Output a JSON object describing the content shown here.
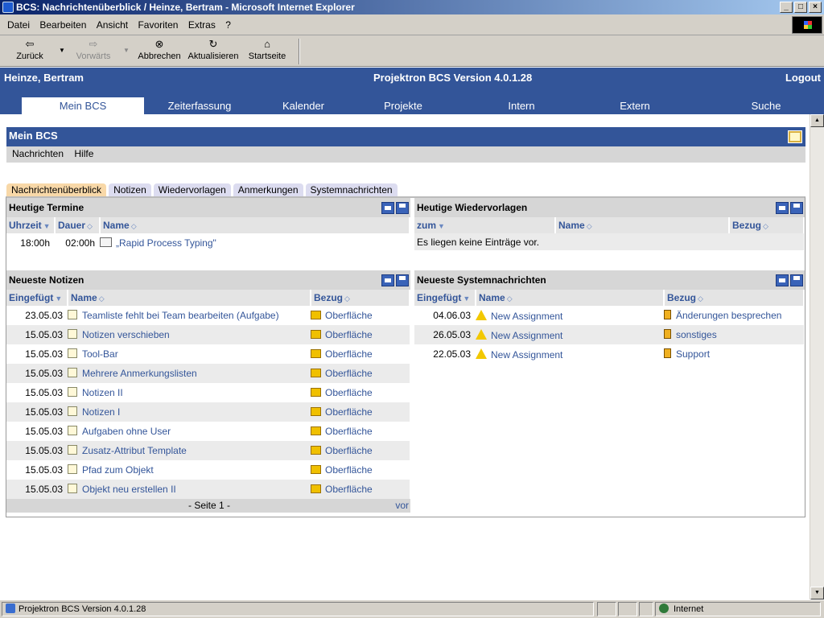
{
  "window": {
    "title": "BCS: Nachrichtenüberblick / Heinze, Bertram - Microsoft Internet Explorer"
  },
  "menu": [
    "Datei",
    "Bearbeiten",
    "Ansicht",
    "Favoriten",
    "Extras",
    "?"
  ],
  "toolbar": {
    "back": "Zurück",
    "forward": "Vorwärts",
    "stop": "Abbrechen",
    "refresh": "Aktualisieren",
    "home": "Startseite"
  },
  "header": {
    "user": "Heinze, Bertram",
    "version": "Projektron BCS Version 4.0.1.28",
    "logout": "Logout"
  },
  "nav": [
    "Mein BCS",
    "Zeiterfassung",
    "Kalender",
    "Projekte",
    "Intern",
    "Extern",
    "Suche"
  ],
  "section": {
    "title": "Mein BCS",
    "menu": [
      "Nachrichten",
      "Hilfe"
    ]
  },
  "subtabs": [
    "Nachrichtenüberblick",
    "Notizen",
    "Wiedervorlagen",
    "Anmerkungen",
    "Systemnachrichten"
  ],
  "termine": {
    "title": "Heutige Termine",
    "headers": [
      "Uhrzeit",
      "Dauer",
      "Name"
    ],
    "rows": [
      {
        "time": "18:00h",
        "duration": "02:00h",
        "name": "„Rapid Process Typing\""
      }
    ]
  },
  "wiedervorlagen": {
    "title": "Heutige Wiedervorlagen",
    "headers": [
      "zum",
      "Name",
      "Bezug"
    ],
    "empty": "Es liegen keine Einträge vor."
  },
  "notizen": {
    "title": "Neueste Notizen",
    "headers": [
      "Eingefügt",
      "Name",
      "Bezug"
    ],
    "rows": [
      {
        "date": "23.05.03",
        "name": "Teamliste fehlt bei Team bearbeiten (Aufgabe)",
        "ref": "Oberfläche"
      },
      {
        "date": "15.05.03",
        "name": "Notizen verschieben",
        "ref": "Oberfläche"
      },
      {
        "date": "15.05.03",
        "name": "Tool-Bar",
        "ref": "Oberfläche"
      },
      {
        "date": "15.05.03",
        "name": "Mehrere Anmerkungslisten",
        "ref": "Oberfläche"
      },
      {
        "date": "15.05.03",
        "name": "Notizen II",
        "ref": "Oberfläche"
      },
      {
        "date": "15.05.03",
        "name": "Notizen I",
        "ref": "Oberfläche"
      },
      {
        "date": "15.05.03",
        "name": "Aufgaben ohne User",
        "ref": "Oberfläche"
      },
      {
        "date": "15.05.03",
        "name": "Zusatz-Attribut Template",
        "ref": "Oberfläche"
      },
      {
        "date": "15.05.03",
        "name": "Pfad zum Objekt",
        "ref": "Oberfläche"
      },
      {
        "date": "15.05.03",
        "name": "Objekt neu erstellen II",
        "ref": "Oberfläche"
      }
    ],
    "pager": "- Seite 1 -",
    "next": "vor"
  },
  "system": {
    "title": "Neueste Systemnachrichten",
    "headers": [
      "Eingefügt",
      "Name",
      "Bezug"
    ],
    "rows": [
      {
        "date": "04.06.03",
        "name": "New Assignment",
        "ref": "Änderungen besprechen"
      },
      {
        "date": "26.05.03",
        "name": "New Assignment",
        "ref": "sonstiges"
      },
      {
        "date": "22.05.03",
        "name": "New Assignment",
        "ref": "Support"
      }
    ]
  },
  "statusbar": {
    "text": "Projektron BCS Version 4.0.1.28",
    "zone": "Internet"
  }
}
